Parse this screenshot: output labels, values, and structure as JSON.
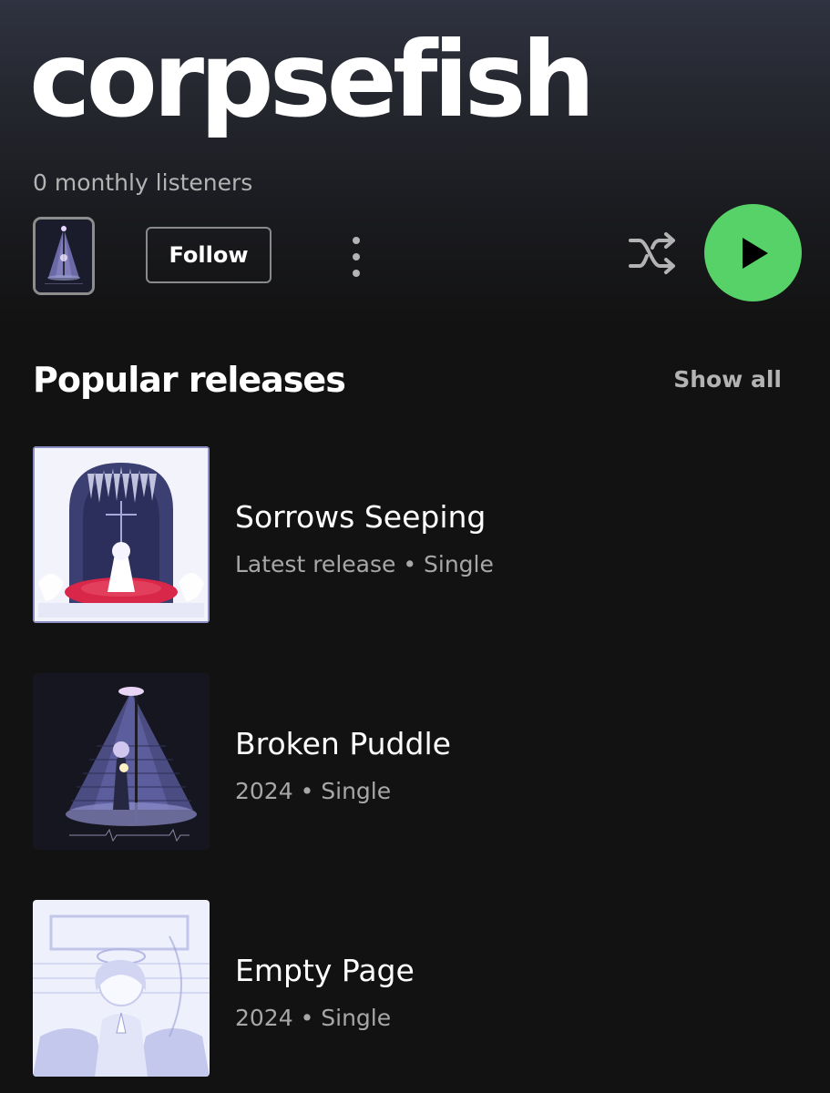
{
  "artist": {
    "name": "corpsefish",
    "monthly_listeners": "0 monthly listeners"
  },
  "controls": {
    "follow_label": "Follow",
    "more_icon": "more-vertical-icon",
    "shuffle_icon": "shuffle-icon",
    "play_icon": "play-icon",
    "accent_color": "#56d268"
  },
  "popular_releases": {
    "title": "Popular releases",
    "show_all_label": "Show all",
    "items": [
      {
        "title": "Sorrows Seeping",
        "meta": "Latest release • Single"
      },
      {
        "title": "Broken Puddle",
        "meta": "2024 • Single"
      },
      {
        "title": "Empty Page",
        "meta": "2024 • Single"
      }
    ]
  }
}
